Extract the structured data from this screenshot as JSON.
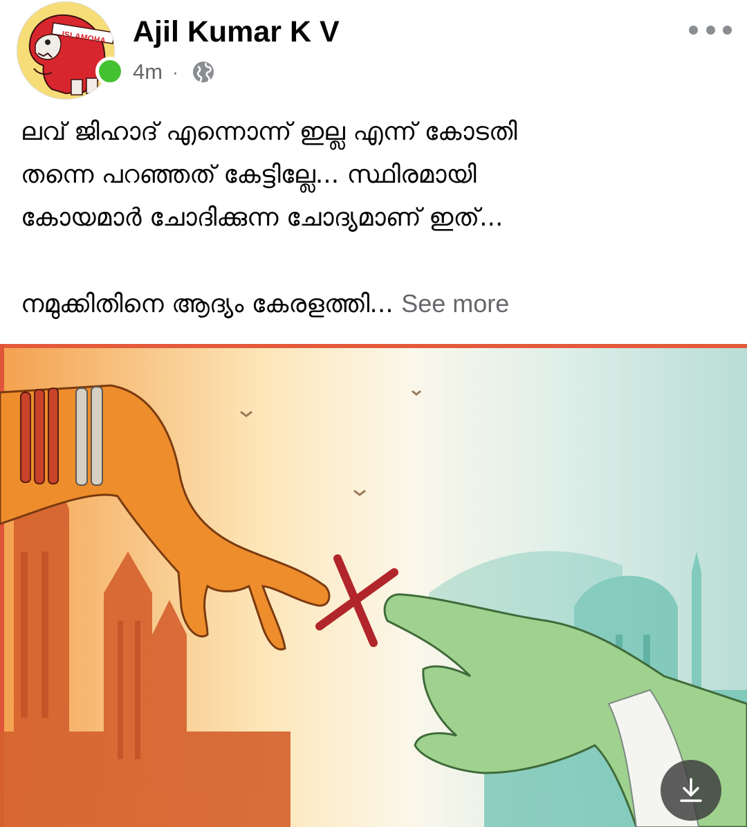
{
  "post": {
    "author_name": "Ajil Kumar K V",
    "timestamp": "4m",
    "separator": "·",
    "audience_icon": "globe-icon",
    "more_icon": "more-horizontal-icon",
    "avatar_text": "ISLAMOHA",
    "online_status_color": "#44c131",
    "text_lines": [
      "ലവ് ജിഹാദ് എന്നൊന്ന് ഇല്ല എന്ന് കോടതി",
      "തന്നെ പറഞ്ഞത് കേട്ടില്ലേ... സ്ഥിരമായി",
      "കോയമാർ ചോദിക്കുന്ന ചോദ്യമാണ് ഇത്..."
    ],
    "text_last_line": "നമുക്കിതിനെ ആദ്യം കേരളത്തി...",
    "see_more_label": "See more",
    "download_icon": "download-icon"
  }
}
